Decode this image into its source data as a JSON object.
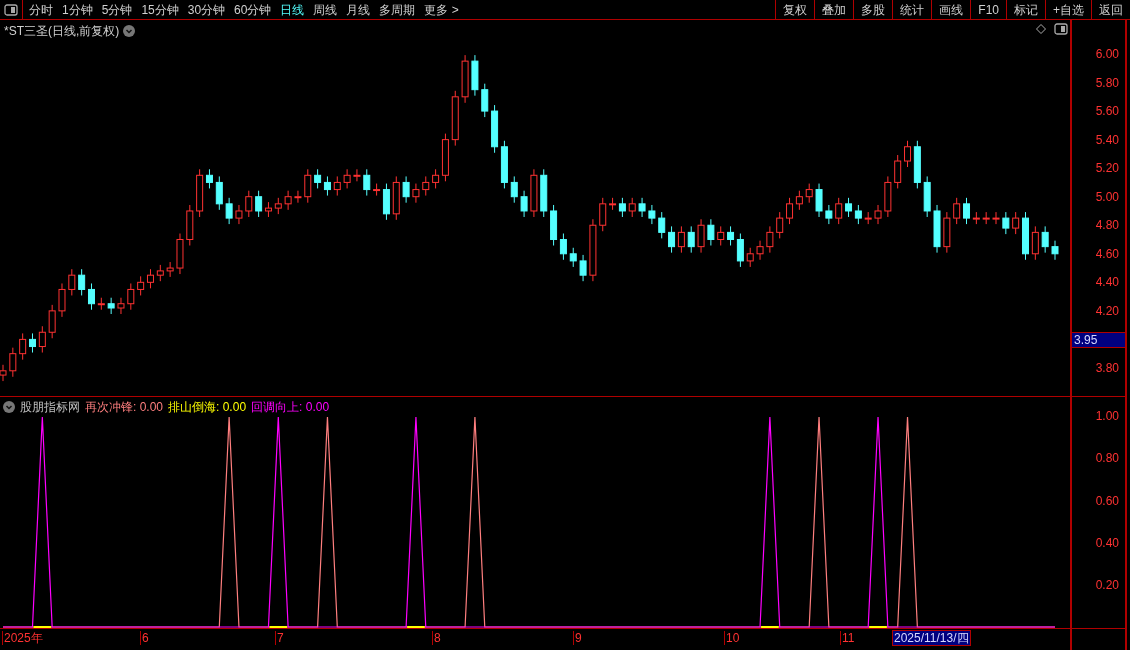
{
  "toolbar": {
    "periods": [
      {
        "label": "分时",
        "selected": false
      },
      {
        "label": "1分钟",
        "selected": false
      },
      {
        "label": "5分钟",
        "selected": false
      },
      {
        "label": "15分钟",
        "selected": false
      },
      {
        "label": "30分钟",
        "selected": false
      },
      {
        "label": "60分钟",
        "selected": false
      },
      {
        "label": "日线",
        "selected": true
      },
      {
        "label": "周线",
        "selected": false
      },
      {
        "label": "月线",
        "selected": false
      },
      {
        "label": "多周期",
        "selected": false
      },
      {
        "label": "更多 >",
        "selected": false
      }
    ],
    "actions": [
      "复权",
      "叠加",
      "多股",
      "统计",
      "画线",
      "F10",
      "标记",
      "+自选",
      "返回"
    ]
  },
  "main_chart": {
    "title": "*ST三圣(日线,前复权)",
    "price_axis": {
      "ticks": [
        "6.00",
        "5.80",
        "5.60",
        "5.40",
        "5.20",
        "5.00",
        "4.80",
        "4.60",
        "4.40",
        "4.20",
        "3.80"
      ],
      "current_price": "3.95"
    }
  },
  "indicator": {
    "name": "股朋指标网",
    "legend": [
      {
        "label": "再次冲锋",
        "readout": ": 0.00",
        "color": "#ff7f7f"
      },
      {
        "label": "排山倒海",
        "readout": ": 0.00",
        "color": "#ffff00"
      },
      {
        "label": "回调向上",
        "readout": ": 0.00",
        "color": "#ff00ff"
      }
    ],
    "axis_ticks": [
      "1.00",
      "0.80",
      "0.60",
      "0.40",
      "0.20"
    ]
  },
  "date_axis": {
    "labels": [
      "2025年",
      "6",
      "7",
      "8",
      "9",
      "10",
      "11"
    ],
    "cursor_date": "2025/11/13/四"
  }
}
